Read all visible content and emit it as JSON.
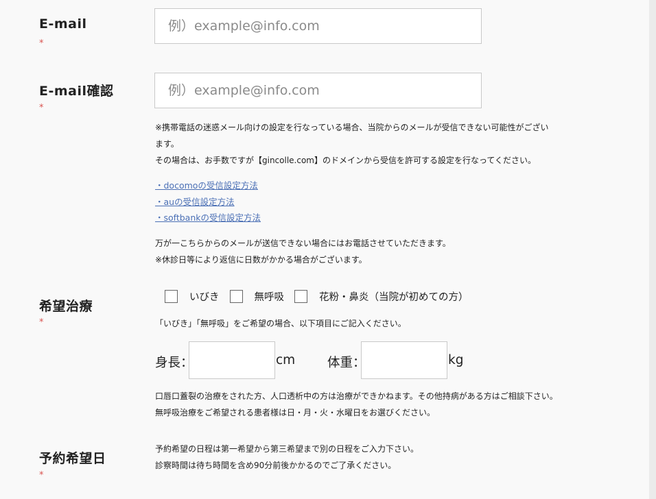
{
  "email": {
    "label": "E-mail",
    "required_mark": "*",
    "placeholder": "例）example@info.com"
  },
  "email_confirm": {
    "label": "E-mail確認",
    "required_mark": "*",
    "placeholder": "例）example@info.com",
    "notes": [
      "※携帯電話の迷惑メール向けの設定を行なっている場合、当院からのメールが受信できない可能性がござい",
      "ます。",
      "その場合は、お手数ですが【gincolle.com】のドメインから受信を許可する設定を行なってください。"
    ],
    "links": [
      "・docomoの受信設定方法",
      "・auの受信設定方法",
      "・softbankの受信設定方法"
    ],
    "notes2": [
      "万が一こちらからのメールが送信できない場合にはお電話させていただきます。",
      "※休診日等により返信に日数がかかる場合がございます。"
    ]
  },
  "treatment": {
    "label": "希望治療",
    "required_mark": "*",
    "options": [
      "いびき",
      "無呼吸",
      "花粉・鼻炎（当院が初めての方）"
    ],
    "note": "「いびき」「無呼吸」をご希望の場合、以下項目にご記入ください。",
    "height_label": "身長：",
    "height_unit": "cm",
    "weight_label": "体重：",
    "weight_unit": "kg",
    "notes": [
      "口唇口蓋裂の治療をされた方、人口透析中の方は治療ができかねます。その他持病がある方はご相談下さい。",
      "無呼吸治療をご希望される患者様は日・月・火・水曜日をお選びください。"
    ]
  },
  "date": {
    "label": "予約希望日",
    "required_mark": "*",
    "notes": [
      "予約希望の日程は第一希望から第三希望まで別の日程をご入力下さい。",
      "診察時間は待ち時間を含め90分前後かかるのでご了承ください。"
    ]
  }
}
